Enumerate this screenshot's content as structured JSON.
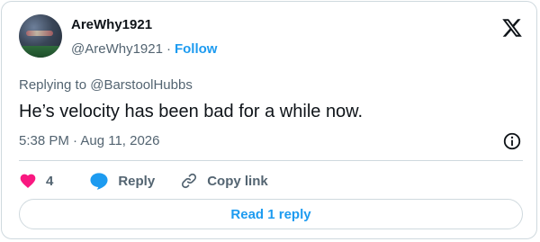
{
  "author": {
    "display_name": "AreWhy1921",
    "handle": "@AreWhy1921",
    "separator": "·",
    "follow_label": "Follow"
  },
  "replying": {
    "prefix": "Replying to ",
    "mention": "@BarstoolHubbs"
  },
  "tweet": {
    "text": "He’s velocity has been bad for a while now.",
    "timestamp": "5:38 PM · Aug 11, 2026"
  },
  "actions": {
    "likes_count": "4",
    "reply_label": "Reply",
    "copy_link_label": "Copy link"
  },
  "read_replies_label": "Read 1 reply",
  "icons": {
    "platform": "x-logo-icon",
    "info": "info-icon",
    "like": "heart-icon",
    "reply": "speech-bubble-icon",
    "copy": "link-icon"
  },
  "colors": {
    "accent": "#1d9bf0",
    "like": "#f91880",
    "secondary_text": "#536471",
    "primary_text": "#0f1419",
    "border": "#cfd9de"
  }
}
